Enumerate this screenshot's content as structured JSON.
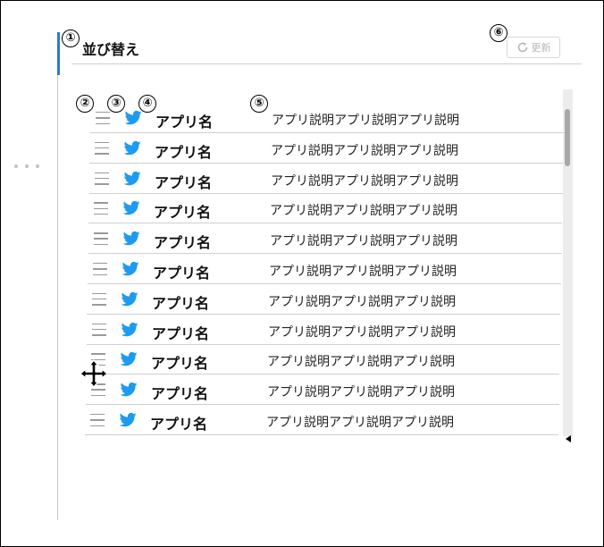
{
  "section": {
    "title": "並び替え",
    "refresh_label": "更新"
  },
  "annotations": [
    "①",
    "②",
    "③",
    "④",
    "⑤",
    "⑥"
  ],
  "icons": {
    "drag_handle": "hamburger-icon",
    "app": "twitter-bird-icon",
    "refresh": "refresh-icon",
    "cursor": "move-cursor-icon"
  },
  "colors": {
    "accent": "#2b78d6",
    "twitter": "#1d9bf0"
  },
  "rows": [
    {
      "name": "アプリ名",
      "description": "アプリ説明アプリ説明アプリ説明"
    },
    {
      "name": "アプリ名",
      "description": "アプリ説明アプリ説明アプリ説明"
    },
    {
      "name": "アプリ名",
      "description": "アプリ説明アプリ説明アプリ説明"
    },
    {
      "name": "アプリ名",
      "description": "アプリ説明アプリ説明アプリ説明"
    },
    {
      "name": "アプリ名",
      "description": "アプリ説明アプリ説明アプリ説明"
    },
    {
      "name": "アプリ名",
      "description": "アプリ説明アプリ説明アプリ説明"
    },
    {
      "name": "アプリ名",
      "description": "アプリ説明アプリ説明アプリ説明"
    },
    {
      "name": "アプリ名",
      "description": "アプリ説明アプリ説明アプリ説明"
    },
    {
      "name": "アプリ名",
      "description": "アプリ説明アプリ説明アプリ説明"
    },
    {
      "name": "アプリ名",
      "description": "アプリ説明アプリ説明アプリ説明"
    },
    {
      "name": "アプリ名",
      "description": "アプリ説明アプリ説明アプリ説明"
    }
  ]
}
